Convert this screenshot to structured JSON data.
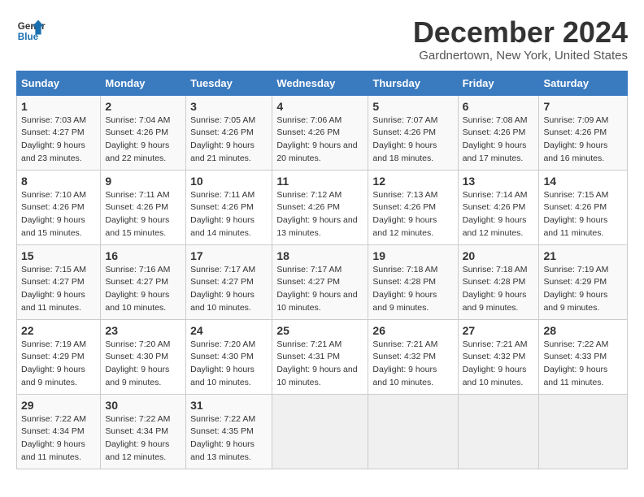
{
  "logo": {
    "line1": "General",
    "line2": "Blue"
  },
  "title": "December 2024",
  "subtitle": "Gardnertown, New York, United States",
  "weekdays": [
    "Sunday",
    "Monday",
    "Tuesday",
    "Wednesday",
    "Thursday",
    "Friday",
    "Saturday"
  ],
  "weeks": [
    [
      {
        "day": "1",
        "sunrise": "7:03 AM",
        "sunset": "4:27 PM",
        "daylight": "9 hours and 23 minutes."
      },
      {
        "day": "2",
        "sunrise": "7:04 AM",
        "sunset": "4:26 PM",
        "daylight": "9 hours and 22 minutes."
      },
      {
        "day": "3",
        "sunrise": "7:05 AM",
        "sunset": "4:26 PM",
        "daylight": "9 hours and 21 minutes."
      },
      {
        "day": "4",
        "sunrise": "7:06 AM",
        "sunset": "4:26 PM",
        "daylight": "9 hours and 20 minutes."
      },
      {
        "day": "5",
        "sunrise": "7:07 AM",
        "sunset": "4:26 PM",
        "daylight": "9 hours and 18 minutes."
      },
      {
        "day": "6",
        "sunrise": "7:08 AM",
        "sunset": "4:26 PM",
        "daylight": "9 hours and 17 minutes."
      },
      {
        "day": "7",
        "sunrise": "7:09 AM",
        "sunset": "4:26 PM",
        "daylight": "9 hours and 16 minutes."
      }
    ],
    [
      {
        "day": "8",
        "sunrise": "7:10 AM",
        "sunset": "4:26 PM",
        "daylight": "9 hours and 15 minutes."
      },
      {
        "day": "9",
        "sunrise": "7:11 AM",
        "sunset": "4:26 PM",
        "daylight": "9 hours and 15 minutes."
      },
      {
        "day": "10",
        "sunrise": "7:11 AM",
        "sunset": "4:26 PM",
        "daylight": "9 hours and 14 minutes."
      },
      {
        "day": "11",
        "sunrise": "7:12 AM",
        "sunset": "4:26 PM",
        "daylight": "9 hours and 13 minutes."
      },
      {
        "day": "12",
        "sunrise": "7:13 AM",
        "sunset": "4:26 PM",
        "daylight": "9 hours and 12 minutes."
      },
      {
        "day": "13",
        "sunrise": "7:14 AM",
        "sunset": "4:26 PM",
        "daylight": "9 hours and 12 minutes."
      },
      {
        "day": "14",
        "sunrise": "7:15 AM",
        "sunset": "4:26 PM",
        "daylight": "9 hours and 11 minutes."
      }
    ],
    [
      {
        "day": "15",
        "sunrise": "7:15 AM",
        "sunset": "4:27 PM",
        "daylight": "9 hours and 11 minutes."
      },
      {
        "day": "16",
        "sunrise": "7:16 AM",
        "sunset": "4:27 PM",
        "daylight": "9 hours and 10 minutes."
      },
      {
        "day": "17",
        "sunrise": "7:17 AM",
        "sunset": "4:27 PM",
        "daylight": "9 hours and 10 minutes."
      },
      {
        "day": "18",
        "sunrise": "7:17 AM",
        "sunset": "4:27 PM",
        "daylight": "9 hours and 10 minutes."
      },
      {
        "day": "19",
        "sunrise": "7:18 AM",
        "sunset": "4:28 PM",
        "daylight": "9 hours and 9 minutes."
      },
      {
        "day": "20",
        "sunrise": "7:18 AM",
        "sunset": "4:28 PM",
        "daylight": "9 hours and 9 minutes."
      },
      {
        "day": "21",
        "sunrise": "7:19 AM",
        "sunset": "4:29 PM",
        "daylight": "9 hours and 9 minutes."
      }
    ],
    [
      {
        "day": "22",
        "sunrise": "7:19 AM",
        "sunset": "4:29 PM",
        "daylight": "9 hours and 9 minutes."
      },
      {
        "day": "23",
        "sunrise": "7:20 AM",
        "sunset": "4:30 PM",
        "daylight": "9 hours and 9 minutes."
      },
      {
        "day": "24",
        "sunrise": "7:20 AM",
        "sunset": "4:30 PM",
        "daylight": "9 hours and 10 minutes."
      },
      {
        "day": "25",
        "sunrise": "7:21 AM",
        "sunset": "4:31 PM",
        "daylight": "9 hours and 10 minutes."
      },
      {
        "day": "26",
        "sunrise": "7:21 AM",
        "sunset": "4:32 PM",
        "daylight": "9 hours and 10 minutes."
      },
      {
        "day": "27",
        "sunrise": "7:21 AM",
        "sunset": "4:32 PM",
        "daylight": "9 hours and 10 minutes."
      },
      {
        "day": "28",
        "sunrise": "7:22 AM",
        "sunset": "4:33 PM",
        "daylight": "9 hours and 11 minutes."
      }
    ],
    [
      {
        "day": "29",
        "sunrise": "7:22 AM",
        "sunset": "4:34 PM",
        "daylight": "9 hours and 11 minutes."
      },
      {
        "day": "30",
        "sunrise": "7:22 AM",
        "sunset": "4:34 PM",
        "daylight": "9 hours and 12 minutes."
      },
      {
        "day": "31",
        "sunrise": "7:22 AM",
        "sunset": "4:35 PM",
        "daylight": "9 hours and 13 minutes."
      },
      null,
      null,
      null,
      null
    ]
  ]
}
